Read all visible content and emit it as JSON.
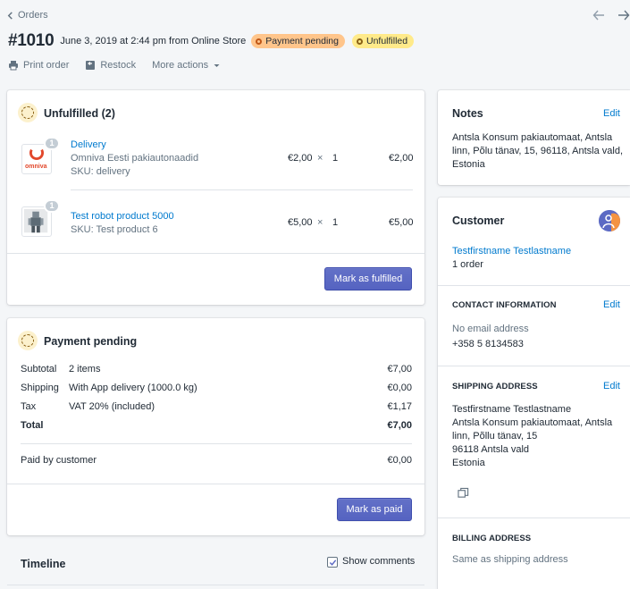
{
  "nav": {
    "back_label": "Orders"
  },
  "header": {
    "order_number": "#1010",
    "meta": "June 3, 2019 at 2:44 pm from Online Store",
    "payment_badge": "Payment pending",
    "fulfillment_badge": "Unfulfilled"
  },
  "actions": {
    "print": "Print order",
    "restock": "Restock",
    "more": "More actions"
  },
  "unfulfilled": {
    "title": "Unfulfilled (2)",
    "items": [
      {
        "qty": "1",
        "name": "Delivery",
        "variant": "Omniva Eesti pakiautonaadid",
        "sku": "SKU: delivery",
        "price": "€2,00",
        "times": "×",
        "count": "1",
        "total": "€2,00",
        "thumb_text": "omniva"
      },
      {
        "qty": "1",
        "name": "Test robot product 5000",
        "sku": "SKU: Test product 6",
        "price": "€5,00",
        "times": "×",
        "count": "1",
        "total": "€5,00"
      }
    ],
    "button": "Mark as fulfilled"
  },
  "payment": {
    "title": "Payment pending",
    "rows": [
      {
        "label": "Subtotal",
        "detail": "2 items",
        "amount": "€7,00"
      },
      {
        "label": "Shipping",
        "detail": "With App delivery (1000.0 kg)",
        "amount": "€0,00"
      },
      {
        "label": "Tax",
        "detail": "VAT 20% (included)",
        "amount": "€1,17"
      }
    ],
    "total_label": "Total",
    "total_amount": "€7,00",
    "paid_label": "Paid by customer",
    "paid_amount": "€0,00",
    "button": "Mark as paid"
  },
  "timeline": {
    "title": "Timeline",
    "show_comments": "Show comments"
  },
  "notes": {
    "title": "Notes",
    "edit": "Edit",
    "line1": "Antsla Konsum pakiautomaat, Antsla",
    "line2": "linn, Põlu tänav, 15, 96118, Antsla vald,",
    "line3": "Estonia"
  },
  "customer": {
    "title": "Customer",
    "name": "Testfirstname Testlastname",
    "orders": "1 order",
    "contact_label": "CONTACT INFORMATION",
    "contact_edit": "Edit",
    "email": "No email address",
    "phone": "+358 5 8134583",
    "shipping_label": "SHIPPING ADDRESS",
    "shipping_edit": "Edit",
    "ship1": "Testfirstname Testlastname",
    "ship2": "Antsla Konsum pakiautomaat, Antsla",
    "ship3": "linn, Põllu tänav, 15",
    "ship4": "96118 Antsla vald",
    "ship5": "Estonia",
    "billing_label": "BILLING ADDRESS",
    "billing": "Same as shipping address"
  },
  "colors": {
    "accent": "#5c6ac4",
    "link": "#007ace",
    "pending_badge": "#ffc58b",
    "unfulfilled_badge": "#ffea8a"
  }
}
